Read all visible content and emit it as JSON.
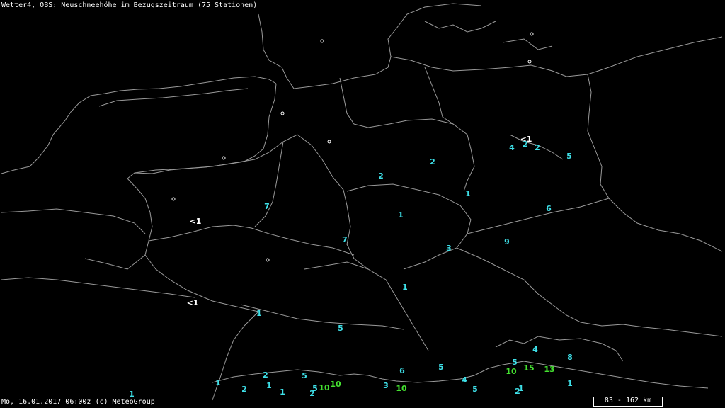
{
  "title": "Wetter4, OBS: Neuschneehöhe im Bezugszeitraum (75 Stationen)",
  "footer": "Mo, 16.01.2017 06:00z (c) MeteoGroup",
  "scale_label": "83 - 162 km",
  "colors": {
    "background": "#000000",
    "border": "#9a9a9a",
    "text": "#ffffff",
    "value_low": "#3ee0e8",
    "value_high": "#44e030",
    "value_trace": "#ffffff"
  },
  "stations": [
    {
      "value": "<1",
      "level": "trace"
    },
    {
      "value": "4",
      "level": "low"
    },
    {
      "value": "2",
      "level": "low"
    },
    {
      "value": "2",
      "level": "low"
    },
    {
      "value": "5",
      "level": "low"
    },
    {
      "value": "2",
      "level": "low"
    },
    {
      "value": "2",
      "level": "low"
    },
    {
      "value": "1",
      "level": "low"
    },
    {
      "value": "6",
      "level": "low"
    },
    {
      "value": "7",
      "level": "low"
    },
    {
      "value": "<1",
      "level": "trace"
    },
    {
      "value": "1",
      "level": "low"
    },
    {
      "value": "7",
      "level": "low"
    },
    {
      "value": "3",
      "level": "low"
    },
    {
      "value": "9",
      "level": "low"
    },
    {
      "value": "1",
      "level": "low"
    },
    {
      "value": "<1",
      "level": "trace"
    },
    {
      "value": "1",
      "level": "low"
    },
    {
      "value": "5",
      "level": "low"
    },
    {
      "value": "4",
      "level": "low"
    },
    {
      "value": "8",
      "level": "low"
    },
    {
      "value": "5",
      "level": "low"
    },
    {
      "value": "10",
      "level": "high"
    },
    {
      "value": "15",
      "level": "high"
    },
    {
      "value": "13",
      "level": "high"
    },
    {
      "value": "6",
      "level": "low"
    },
    {
      "value": "5",
      "level": "low"
    },
    {
      "value": "2",
      "level": "low"
    },
    {
      "value": "5",
      "level": "low"
    },
    {
      "value": "4",
      "level": "low"
    },
    {
      "value": "3",
      "level": "low"
    },
    {
      "value": "10",
      "level": "high"
    },
    {
      "value": "5",
      "level": "low"
    },
    {
      "value": "1",
      "level": "low"
    },
    {
      "value": "2",
      "level": "low"
    },
    {
      "value": "1",
      "level": "low"
    },
    {
      "value": "1",
      "level": "low"
    },
    {
      "value": "2",
      "level": "low"
    },
    {
      "value": "1",
      "level": "low"
    },
    {
      "value": "1",
      "level": "low"
    },
    {
      "value": "5",
      "level": "low"
    },
    {
      "value": "10",
      "level": "high"
    },
    {
      "value": "10",
      "level": "high"
    },
    {
      "value": "2",
      "level": "low"
    },
    {
      "value": "1",
      "level": "low"
    }
  ]
}
